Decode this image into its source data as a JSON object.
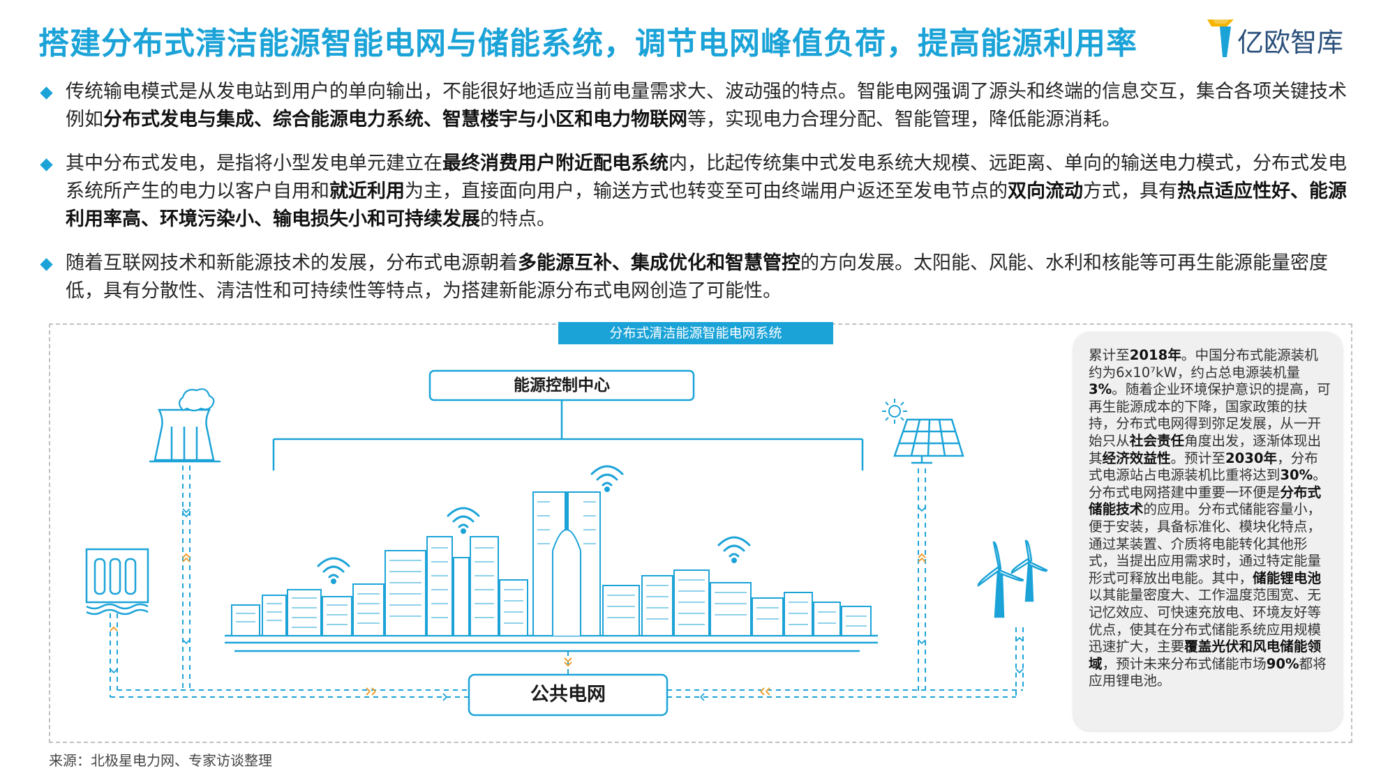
{
  "title": "搭建分布式清洁能源智能电网与储能系统，调节电网峰值负荷，提高能源利用率",
  "logo": {
    "text": "亿欧智库",
    "colors": [
      "#f5b400",
      "#1ba3d8"
    ]
  },
  "bullets": [
    [
      {
        "t": "传统输电模式是从发电站到用户的单向输出，不能很好地适应当前电量需求大、波动强的特点。智能电网强调了源头和终端的信息交互，集合各项关键技术例如",
        "b": false
      },
      {
        "t": "分布式发电与集成、综合能源电力系统、智慧楼宇与小区和电力物联网",
        "b": true
      },
      {
        "t": "等，实现电力合理分配、智能管理，降低能源消耗。",
        "b": false
      }
    ],
    [
      {
        "t": "其中分布式发电，是指将小型发电单元建立在",
        "b": false
      },
      {
        "t": "最终消费用户附近配电系统",
        "b": true
      },
      {
        "t": "内，比起传统集中式发电系统大规模、远距离、单向的输送电力模式，分布式发电系统所产生的电力以客户自用和",
        "b": false
      },
      {
        "t": "就近利用",
        "b": true
      },
      {
        "t": "为主，直接面向用户，输送方式也转变至可由终端用户返还至发电节点的",
        "b": false
      },
      {
        "t": "双向流动",
        "b": true
      },
      {
        "t": "方式，具有",
        "b": false
      },
      {
        "t": "热点适应性好、能源利用率高、环境污染小、输电损失小和可持续发展",
        "b": true
      },
      {
        "t": "的特点。",
        "b": false
      }
    ],
    [
      {
        "t": "随着互联网技术和新能源技术的发展，分布式电源朝着",
        "b": false
      },
      {
        "t": "多能源互补、集成优化和智慧管控",
        "b": true
      },
      {
        "t": "的方向发展。太阳能、风能、水利和核能等可再生能源能量密度低，具有分散性、清洁性和可持续性等特点，为搭建新能源分布式电网创造了可能性。",
        "b": false
      }
    ]
  ],
  "diagram": {
    "title": "分布式清洁能源智能电网系统",
    "control_center": "能源控制中心",
    "public_grid": "公共电网",
    "accent_color": "#1ba3d8",
    "flow_arrow_color": "#f0a030",
    "icons": [
      "power-plant-icon",
      "hydro-dam-icon",
      "solar-panel-icon",
      "sun-icon",
      "wind-turbine-icon",
      "city-skyline-icon",
      "wifi-signal-icon"
    ]
  },
  "sidebox": [
    {
      "t": "累计至",
      "b": false
    },
    {
      "t": "2018年",
      "b": true
    },
    {
      "t": "。中国分布式能源装机约为6x10⁷kW，约占总电源装机量",
      "b": false
    },
    {
      "t": "3%",
      "b": true
    },
    {
      "t": "。随着企业环境保护意识的提高，可再生能源成本的下降，国家政策的扶持，分布式电网得到弥足发展，从一开始只从",
      "b": false
    },
    {
      "t": "社会责任",
      "b": true
    },
    {
      "t": "角度出发，逐渐体现出其",
      "b": false
    },
    {
      "t": "经济效益性",
      "b": true
    },
    {
      "t": "。预计至",
      "b": false
    },
    {
      "t": "2030年",
      "b": true
    },
    {
      "t": "，分布式电源站占电源装机比重将达到",
      "b": false
    },
    {
      "t": "30%",
      "b": true
    },
    {
      "t": "。\n分布式电网搭建中重要一环便是",
      "b": false
    },
    {
      "t": "分布式储能技术",
      "b": true
    },
    {
      "t": "的应用。分布式储能容量小，便于安装，具备标准化、模块化特点，通过某装置、介质将电能转化其他形式，当提出应用需求时，通过特定能量形式可释放出电能。其中，",
      "b": false
    },
    {
      "t": "储能锂电池",
      "b": true
    },
    {
      "t": "以其能量密度大、工作温度范围宽、无记忆效应、可快速充放电、环境友好等优点，使其在分布式储能系统应用规模迅速扩大，主要",
      "b": false
    },
    {
      "t": "覆盖光伏和风电储能领域",
      "b": true
    },
    {
      "t": "，预计未来分布式储能市场",
      "b": false
    },
    {
      "t": "90%",
      "b": true
    },
    {
      "t": "都将应用锂电池。",
      "b": false
    }
  ],
  "source": "来源：北极星电力网、专家访谈整理"
}
